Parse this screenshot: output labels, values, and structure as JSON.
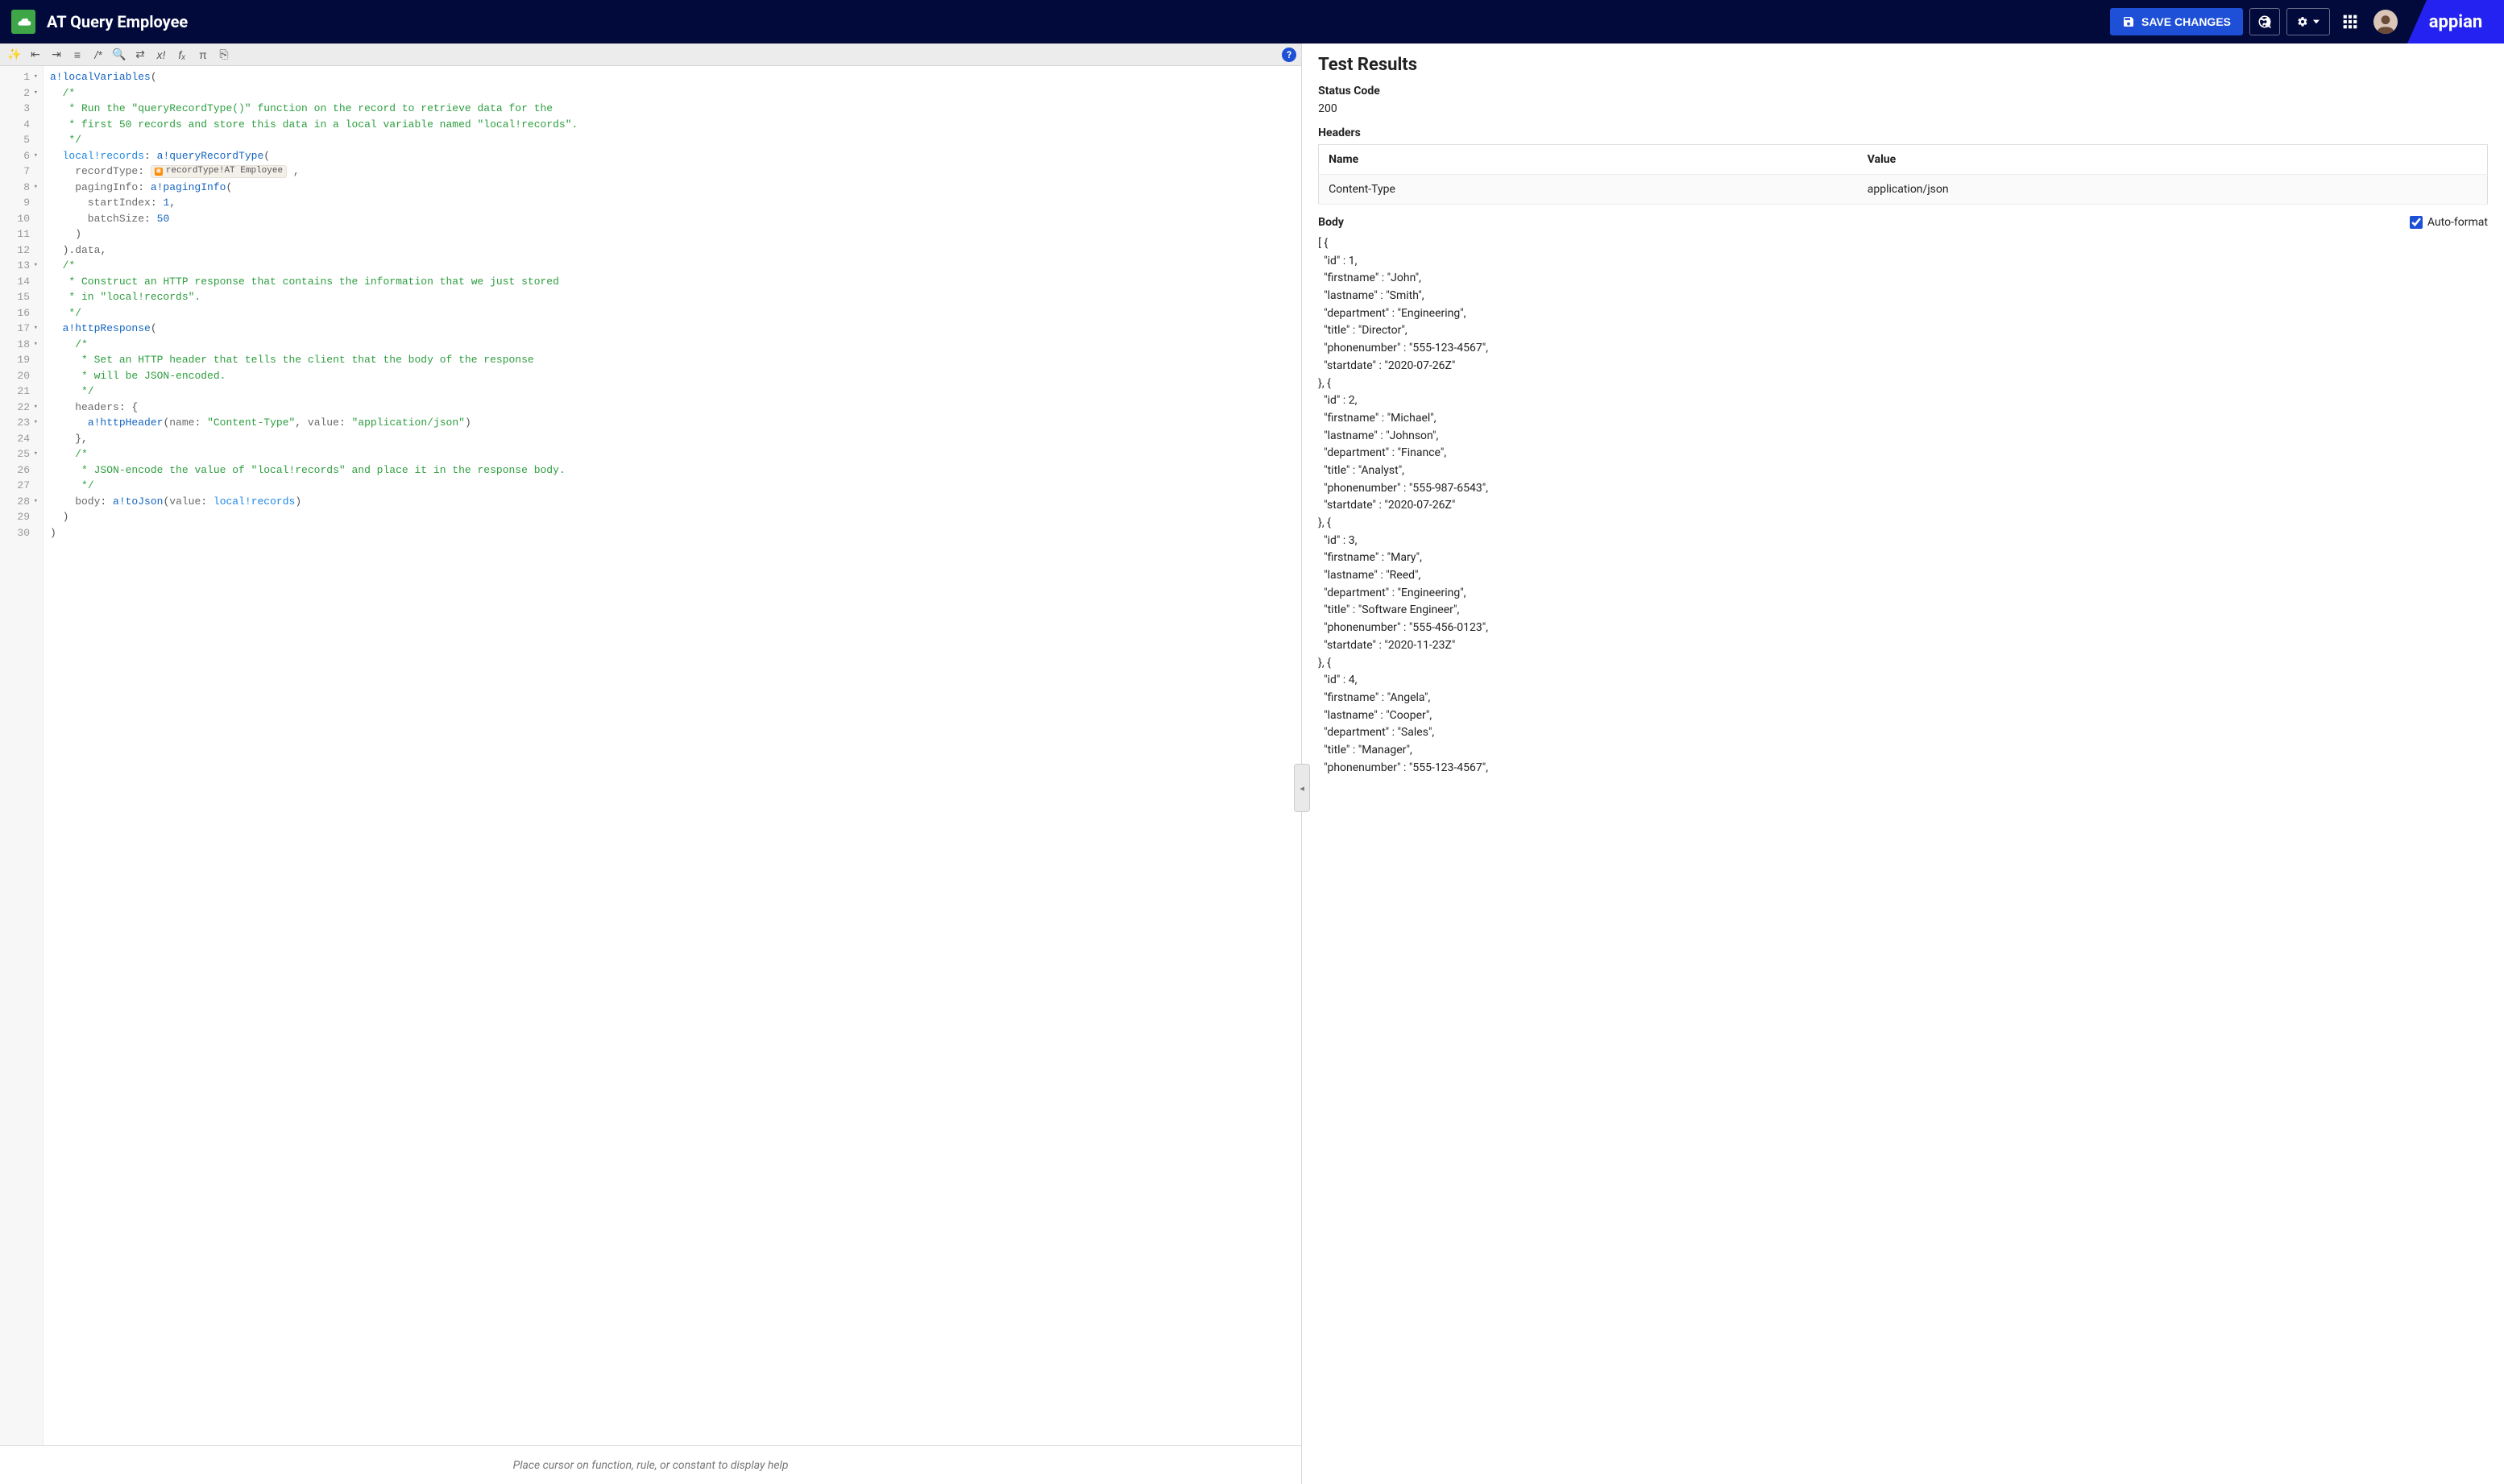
{
  "header": {
    "title": "AT Query Employee",
    "save_label": "SAVE CHANGES",
    "brand": "appian"
  },
  "toolbar": {
    "icons": [
      "magic-wand",
      "outdent",
      "indent",
      "list",
      "comment",
      "search",
      "swap",
      "random",
      "fx",
      "pi",
      "exit"
    ]
  },
  "editor": {
    "hint": "Place cursor on function, rule, or constant to display help",
    "lines": [
      {
        "n": 1,
        "fold": true,
        "tokens": [
          [
            "fn",
            "a!localVariables"
          ],
          [
            "pun",
            "("
          ]
        ]
      },
      {
        "n": 2,
        "fold": true,
        "tokens": [
          [
            "id",
            "  "
          ],
          [
            "cmt",
            "/*"
          ]
        ]
      },
      {
        "n": 3,
        "fold": false,
        "tokens": [
          [
            "id",
            "   "
          ],
          [
            "cmt",
            "* Run the \"queryRecordType()\" function on the record to retrieve data for the"
          ]
        ]
      },
      {
        "n": 4,
        "fold": false,
        "tokens": [
          [
            "id",
            "   "
          ],
          [
            "cmt",
            "* first 50 records and store this data in a local variable named \"local!records\"."
          ]
        ]
      },
      {
        "n": 5,
        "fold": false,
        "tokens": [
          [
            "id",
            "   "
          ],
          [
            "cmt",
            "*/"
          ]
        ]
      },
      {
        "n": 6,
        "fold": true,
        "tokens": [
          [
            "id",
            "  "
          ],
          [
            "var",
            "local!records"
          ],
          [
            "pun",
            ": "
          ],
          [
            "fn",
            "a!queryRecordType"
          ],
          [
            "pun",
            "("
          ]
        ]
      },
      {
        "n": 7,
        "fold": false,
        "tokens": [
          [
            "id",
            "    recordType"
          ],
          [
            "pun",
            ": "
          ],
          [
            "chip",
            "recordType!AT Employee"
          ],
          [
            "pun",
            " ,"
          ]
        ]
      },
      {
        "n": 8,
        "fold": true,
        "tokens": [
          [
            "id",
            "    pagingInfo"
          ],
          [
            "pun",
            ": "
          ],
          [
            "fn",
            "a!pagingInfo"
          ],
          [
            "pun",
            "("
          ]
        ]
      },
      {
        "n": 9,
        "fold": false,
        "tokens": [
          [
            "id",
            "      startIndex"
          ],
          [
            "pun",
            ": "
          ],
          [
            "num",
            "1"
          ],
          [
            "pun",
            ","
          ]
        ]
      },
      {
        "n": 10,
        "fold": false,
        "tokens": [
          [
            "id",
            "      batchSize"
          ],
          [
            "pun",
            ": "
          ],
          [
            "num",
            "50"
          ]
        ]
      },
      {
        "n": 11,
        "fold": false,
        "tokens": [
          [
            "id",
            "    "
          ],
          [
            "pun",
            ")"
          ]
        ]
      },
      {
        "n": 12,
        "fold": false,
        "tokens": [
          [
            "id",
            "  "
          ],
          [
            "pun",
            ")"
          ],
          [
            "pun",
            "."
          ],
          [
            "id",
            "data"
          ],
          [
            "pun",
            ","
          ]
        ]
      },
      {
        "n": 13,
        "fold": true,
        "tokens": [
          [
            "id",
            "  "
          ],
          [
            "cmt",
            "/*"
          ]
        ]
      },
      {
        "n": 14,
        "fold": false,
        "tokens": [
          [
            "id",
            "   "
          ],
          [
            "cmt",
            "* Construct an HTTP response that contains the information that we just stored"
          ]
        ]
      },
      {
        "n": 15,
        "fold": false,
        "tokens": [
          [
            "id",
            "   "
          ],
          [
            "cmt",
            "* in \"local!records\"."
          ]
        ]
      },
      {
        "n": 16,
        "fold": false,
        "tokens": [
          [
            "id",
            "   "
          ],
          [
            "cmt",
            "*/"
          ]
        ]
      },
      {
        "n": 17,
        "fold": true,
        "tokens": [
          [
            "id",
            "  "
          ],
          [
            "fn",
            "a!httpResponse"
          ],
          [
            "pun",
            "("
          ]
        ]
      },
      {
        "n": 18,
        "fold": true,
        "tokens": [
          [
            "id",
            "    "
          ],
          [
            "cmt",
            "/*"
          ]
        ]
      },
      {
        "n": 19,
        "fold": false,
        "tokens": [
          [
            "id",
            "     "
          ],
          [
            "cmt",
            "* Set an HTTP header that tells the client that the body of the response"
          ]
        ]
      },
      {
        "n": 20,
        "fold": false,
        "tokens": [
          [
            "id",
            "     "
          ],
          [
            "cmt",
            "* will be JSON-encoded."
          ]
        ]
      },
      {
        "n": 21,
        "fold": false,
        "tokens": [
          [
            "id",
            "     "
          ],
          [
            "cmt",
            "*/"
          ]
        ]
      },
      {
        "n": 22,
        "fold": true,
        "tokens": [
          [
            "id",
            "    headers"
          ],
          [
            "pun",
            ": {"
          ]
        ]
      },
      {
        "n": 23,
        "fold": true,
        "tokens": [
          [
            "id",
            "      "
          ],
          [
            "fn",
            "a!httpHeader"
          ],
          [
            "pun",
            "("
          ],
          [
            "id",
            "name"
          ],
          [
            "pun",
            ": "
          ],
          [
            "str",
            "\"Content-Type\""
          ],
          [
            "pun",
            ", "
          ],
          [
            "id",
            "value"
          ],
          [
            "pun",
            ": "
          ],
          [
            "str",
            "\"application/json\""
          ],
          [
            "pun",
            ")"
          ]
        ]
      },
      {
        "n": 24,
        "fold": false,
        "tokens": [
          [
            "id",
            "    "
          ],
          [
            "pun",
            "},"
          ]
        ]
      },
      {
        "n": 25,
        "fold": true,
        "tokens": [
          [
            "id",
            "    "
          ],
          [
            "cmt",
            "/*"
          ]
        ]
      },
      {
        "n": 26,
        "fold": false,
        "tokens": [
          [
            "id",
            "     "
          ],
          [
            "cmt",
            "* JSON-encode the value of \"local!records\" and place it in the response body."
          ]
        ]
      },
      {
        "n": 27,
        "fold": false,
        "tokens": [
          [
            "id",
            "     "
          ],
          [
            "cmt",
            "*/"
          ]
        ]
      },
      {
        "n": 28,
        "fold": true,
        "tokens": [
          [
            "id",
            "    body"
          ],
          [
            "pun",
            ": "
          ],
          [
            "fn",
            "a!toJson"
          ],
          [
            "pun",
            "("
          ],
          [
            "id",
            "value"
          ],
          [
            "pun",
            ": "
          ],
          [
            "var",
            "local!records"
          ],
          [
            "pun",
            ")"
          ]
        ]
      },
      {
        "n": 29,
        "fold": false,
        "tokens": [
          [
            "id",
            "  "
          ],
          [
            "pun",
            ")"
          ]
        ]
      },
      {
        "n": 30,
        "fold": false,
        "tokens": [
          [
            "pun",
            ")"
          ]
        ]
      }
    ]
  },
  "results": {
    "title": "Test Results",
    "status_label": "Status Code",
    "status_value": "200",
    "headers_label": "Headers",
    "headers_cols": {
      "name": "Name",
      "value": "Value"
    },
    "headers_rows": [
      {
        "name": "Content-Type",
        "value": "application/json"
      }
    ],
    "body_label": "Body",
    "autoformat_label": "Auto-format",
    "body_text": "[ {\n  \"id\" : 1,\n  \"firstname\" : \"John\",\n  \"lastname\" : \"Smith\",\n  \"department\" : \"Engineering\",\n  \"title\" : \"Director\",\n  \"phonenumber\" : \"555-123-4567\",\n  \"startdate\" : \"2020-07-26Z\"\n}, {\n  \"id\" : 2,\n  \"firstname\" : \"Michael\",\n  \"lastname\" : \"Johnson\",\n  \"department\" : \"Finance\",\n  \"title\" : \"Analyst\",\n  \"phonenumber\" : \"555-987-6543\",\n  \"startdate\" : \"2020-07-26Z\"\n}, {\n  \"id\" : 3,\n  \"firstname\" : \"Mary\",\n  \"lastname\" : \"Reed\",\n  \"department\" : \"Engineering\",\n  \"title\" : \"Software Engineer\",\n  \"phonenumber\" : \"555-456-0123\",\n  \"startdate\" : \"2020-11-23Z\"\n}, {\n  \"id\" : 4,\n  \"firstname\" : \"Angela\",\n  \"lastname\" : \"Cooper\",\n  \"department\" : \"Sales\",\n  \"title\" : \"Manager\",\n  \"phonenumber\" : \"555-123-4567\","
  }
}
